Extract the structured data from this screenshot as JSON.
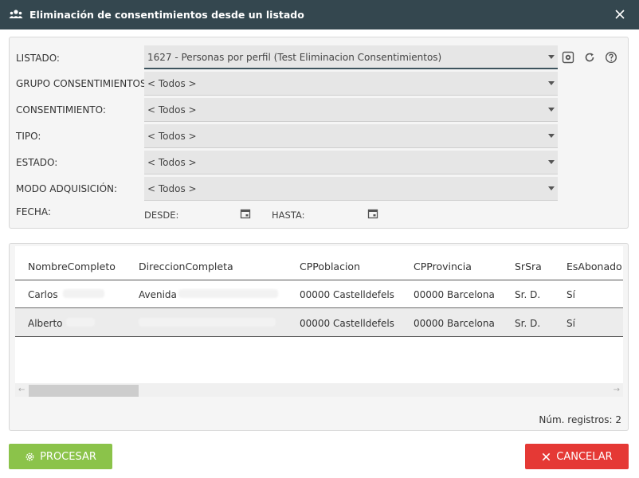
{
  "window": {
    "title": "Eliminación de consentimientos desde un listado",
    "icon": "users-icon",
    "close_icon": "close-icon"
  },
  "filters": {
    "listado": {
      "label": "LISTADO:",
      "value": "1627 - Personas por perfil (Test Eliminacion Consentimientos)"
    },
    "grupo": {
      "label": "GRUPO CONSENTIMIENTOS:",
      "value": "< Todos >"
    },
    "consentimiento": {
      "label": "CONSENTIMIENTO:",
      "value": "< Todos >"
    },
    "tipo": {
      "label": "TIPO:",
      "value": "< Todos >"
    },
    "estado": {
      "label": "ESTADO:",
      "value": "< Todos >"
    },
    "modo": {
      "label": "MODO ADQUISICIÓN:",
      "value": "< Todos >"
    },
    "fecha": {
      "label": "FECHA:",
      "desde_label": "DESDE:",
      "hasta_label": "HASTA:"
    },
    "tools": [
      "settings-icon",
      "refresh-icon",
      "help-icon"
    ]
  },
  "grid": {
    "columns": [
      "NombreCompleto",
      "DireccionCompleta",
      "CPPoblacion",
      "CPProvincia",
      "SrSra",
      "EsAbonado"
    ],
    "rows": [
      {
        "nombre": "Carlos",
        "direccion": "Avenida",
        "poblacion": "00000 Castelldefels",
        "provincia": "00000 Barcelona",
        "srsra": "Sr. D.",
        "abonado": "Sí"
      },
      {
        "nombre": "Alberto",
        "direccion": "",
        "poblacion": "00000 Castelldefels",
        "provincia": "00000 Barcelona",
        "srsra": "Sr. D.",
        "abonado": "Sí"
      }
    ],
    "record_count": "Núm. registros: 2"
  },
  "actions": {
    "process_label": "PROCESAR",
    "cancel_label": "CANCELAR"
  },
  "colors": {
    "titlebar": "#34474f",
    "process": "#8bc34a",
    "cancel": "#e53935"
  }
}
